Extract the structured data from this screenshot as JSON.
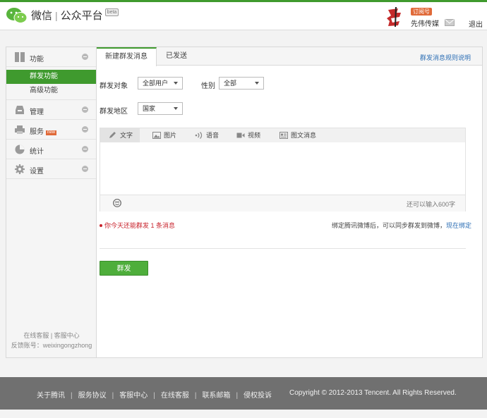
{
  "header": {
    "brand": "微信",
    "platform": "公众平台",
    "beta": "beta",
    "account_badge": "订阅号",
    "account_name": "先伟传媒",
    "logout": "退出"
  },
  "sidebar": {
    "groups": [
      {
        "label": "功能",
        "icon": "grid-icon"
      },
      {
        "label": "管理",
        "icon": "inbox-icon"
      },
      {
        "label": "服务",
        "icon": "printer-icon",
        "badge": "new"
      },
      {
        "label": "统计",
        "icon": "pie-chart-icon"
      },
      {
        "label": "设置",
        "icon": "gear-icon"
      }
    ],
    "sub_items": [
      {
        "label": "群发功能",
        "active": true
      },
      {
        "label": "高级功能",
        "active": false
      }
    ],
    "footer_line1": "在线客服 | 客服中心",
    "footer_line2": "反馈账号：weixingongzhong"
  },
  "tabs": {
    "items": [
      "新建群发消息",
      "已发送"
    ],
    "rules_link": "群发消息规则说明"
  },
  "form": {
    "target_label": "群发对象",
    "target_value": "全部用户",
    "gender_label": "性别",
    "gender_value": "全部",
    "region_label": "群发地区",
    "region_value": "国家"
  },
  "editor": {
    "tools": [
      {
        "label": "文字",
        "icon": "pencil-icon"
      },
      {
        "label": "图片",
        "icon": "image-icon"
      },
      {
        "label": "语音",
        "icon": "voice-icon"
      },
      {
        "label": "视频",
        "icon": "video-icon"
      },
      {
        "label": "图文消息",
        "icon": "article-icon"
      }
    ],
    "counter": "还可以输入600字"
  },
  "warning": "你今天还能群发 1 条消息",
  "hint_text": "绑定腾讯微博后，可以同步群发到微博，",
  "hint_link": "现在绑定",
  "send_label": "群发",
  "footer": {
    "links": [
      "关于腾讯",
      "服务协议",
      "客服中心",
      "在线客服",
      "联系邮箱",
      "侵权投诉"
    ],
    "copyright": "Copyright © 2012-2013 Tencent. All Rights Reserved."
  },
  "colors": {
    "accent": "#3f9a2e",
    "button": "#4eae3b",
    "warning": "#c8232c",
    "link": "#2d6fb5",
    "footer_bg": "#707070"
  }
}
